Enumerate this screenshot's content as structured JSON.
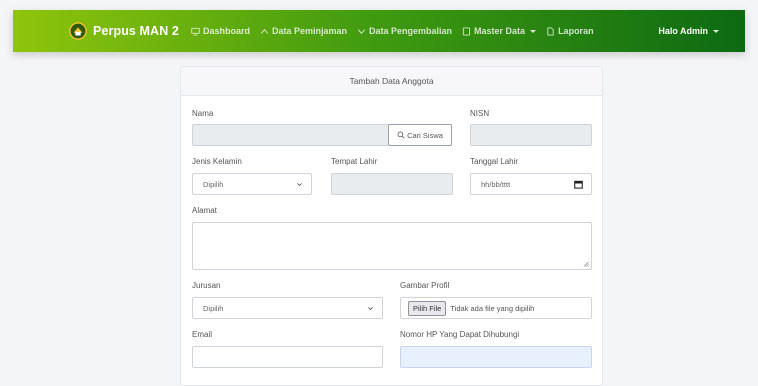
{
  "navbar": {
    "brand": "Perpus MAN 2",
    "links": [
      {
        "label": "Dashboard",
        "icon": "monitor-icon"
      },
      {
        "label": "Data Peminjaman",
        "icon": "arrow-up-icon"
      },
      {
        "label": "Data Pengembalian",
        "icon": "arrow-down-icon"
      },
      {
        "label": "Master Data",
        "icon": "folder-icon",
        "dropdown": true
      },
      {
        "label": "Laporan",
        "icon": "document-icon"
      }
    ],
    "user": "Halo Admin"
  },
  "form": {
    "title": "Tambah Data Anggota",
    "nama": {
      "label": "Nama",
      "value": ""
    },
    "cari_button": "Cari Siswa",
    "nisn": {
      "label": "NISN",
      "value": ""
    },
    "jenis_kelamin": {
      "label": "Jenis Kelamin",
      "selected": "Dipilih"
    },
    "tempat_lahir": {
      "label": "Tempat Lahir",
      "value": ""
    },
    "tanggal_lahir": {
      "label": "Tanggal Lahir",
      "placeholder": "hh/bb/tttt"
    },
    "alamat": {
      "label": "Alamat",
      "value": ""
    },
    "jurusan": {
      "label": "Jurusan",
      "selected": "Dipilih"
    },
    "gambar_profil": {
      "label": "Gambar Profil",
      "button": "Pilih File",
      "status": "Tidak ada file yang dipilih"
    },
    "email": {
      "label": "Email",
      "value": ""
    },
    "nomor_hp": {
      "label": "Nomor HP Yang Dapat Dihubungi",
      "value": ""
    }
  },
  "colors": {
    "navbar_start": "#8fc40c",
    "navbar_end": "#0d6a12",
    "page_bg": "#f4f5f7"
  }
}
